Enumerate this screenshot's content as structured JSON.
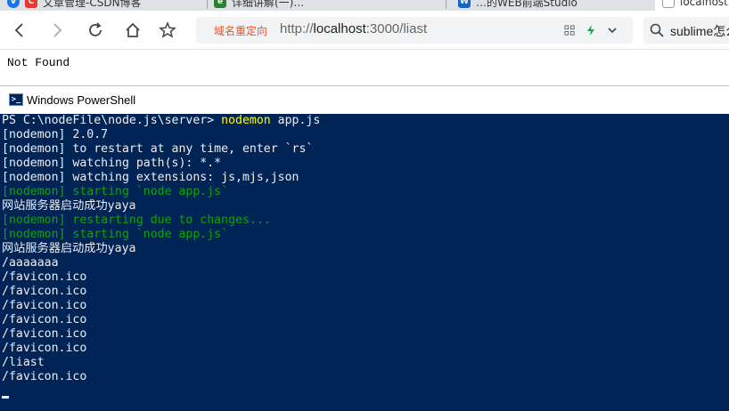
{
  "browser": {
    "tabs": [
      {
        "label": "文章管理-CSDN博客",
        "active": false
      },
      {
        "label": "详细讲解(一)…",
        "active": false
      },
      {
        "label": "…的WEB前端Studio",
        "active": false
      },
      {
        "label": "localhost…",
        "active": true
      }
    ],
    "redirect_tag": "域名重定向",
    "url_prefix": "http://",
    "url_host": "localhost",
    "url_rest": ":3000/liast",
    "search_text": "sublime怎么"
  },
  "page": {
    "body_text": "Not Found"
  },
  "powershell": {
    "title": "Windows PowerShell",
    "lines": [
      {
        "color": "white",
        "text": "PS C:\\nodeFile\\node.js\\server> ",
        "suffix": "nodemon",
        "suffix_color": "yellow",
        "suffix2": " app.js"
      },
      {
        "color": "white",
        "text": "[nodemon] 2.0.7"
      },
      {
        "color": "white",
        "text": "[nodemon] to restart at any time, enter `rs`"
      },
      {
        "color": "white",
        "text": "[nodemon] watching path(s): *.*"
      },
      {
        "color": "white",
        "text": "[nodemon] watching extensions: js,mjs,json"
      },
      {
        "color": "green",
        "text": "[nodemon] starting `node app.js`"
      },
      {
        "color": "white",
        "text": "网站服务器启动成功yaya"
      },
      {
        "color": "green",
        "text": "[nodemon] restarting due to changes..."
      },
      {
        "color": "green",
        "text": "[nodemon] starting `node app.js`"
      },
      {
        "color": "white",
        "text": "网站服务器启动成功yaya"
      },
      {
        "color": "white",
        "text": "/aaaaaaa"
      },
      {
        "color": "white",
        "text": "/favicon.ico"
      },
      {
        "color": "white",
        "text": "/favicon.ico"
      },
      {
        "color": "white",
        "text": "/favicon.ico"
      },
      {
        "color": "white",
        "text": "/favicon.ico"
      },
      {
        "color": "white",
        "text": "/favicon.ico"
      },
      {
        "color": "white",
        "text": "/favicon.ico"
      },
      {
        "color": "white",
        "text": "/liast"
      },
      {
        "color": "white",
        "text": "/favicon.ico"
      }
    ]
  },
  "colors": {
    "console_bg": "#012456",
    "console_text": "#eeedf0",
    "command_yellow": "#fefe00",
    "nodemon_green": "#13a10e",
    "redirect_tag": "#e8542c"
  },
  "icons": {
    "back": "arrow-left-icon",
    "forward": "arrow-right-icon",
    "reload": "reload-icon",
    "home": "home-icon",
    "bookmark": "star-icon",
    "grid": "grid-icon",
    "lightning": "lightning-icon",
    "dropdown": "chevron-down-icon",
    "search": "search-icon",
    "powershell": "powershell-icon"
  }
}
